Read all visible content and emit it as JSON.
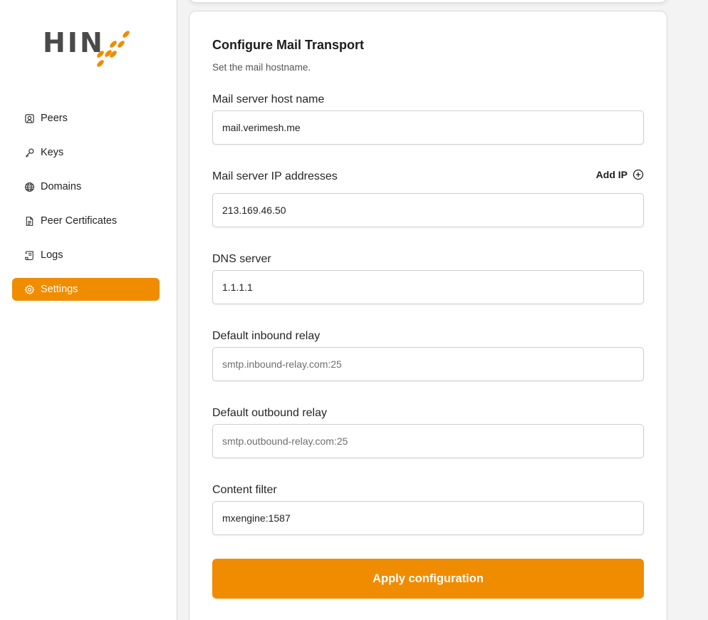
{
  "logo": {
    "text": "HIN",
    "accent_color": "#f08c00"
  },
  "sidebar": {
    "items": [
      {
        "label": "Peers",
        "icon": "user-square-icon",
        "active": false
      },
      {
        "label": "Keys",
        "icon": "key-icon",
        "active": false
      },
      {
        "label": "Domains",
        "icon": "globe-icon",
        "active": false
      },
      {
        "label": "Peer Certificates",
        "icon": "document-icon",
        "active": false
      },
      {
        "label": "Logs",
        "icon": "scroll-icon",
        "active": false
      },
      {
        "label": "Settings",
        "icon": "gear-icon",
        "active": true
      }
    ]
  },
  "card": {
    "title": "Configure Mail Transport",
    "subtitle": "Set the mail hostname.",
    "fields": {
      "hostname": {
        "label": "Mail server host name",
        "value": "mail.verimesh.me",
        "placeholder": ""
      },
      "ip": {
        "label": "Mail server IP addresses",
        "value": "213.169.46.50",
        "placeholder": "",
        "add_label": "Add IP"
      },
      "dns": {
        "label": "DNS server",
        "value": "1.1.1.1",
        "placeholder": ""
      },
      "inbound": {
        "label": "Default inbound relay",
        "value": "",
        "placeholder": "smtp.inbound-relay.com:25"
      },
      "outbound": {
        "label": "Default outbound relay",
        "value": "",
        "placeholder": "smtp.outbound-relay.com:25"
      },
      "filter": {
        "label": "Content filter",
        "value": "mxengine:1587",
        "placeholder": ""
      }
    },
    "apply_label": "Apply configuration"
  },
  "colors": {
    "accent": "#f08c00"
  }
}
